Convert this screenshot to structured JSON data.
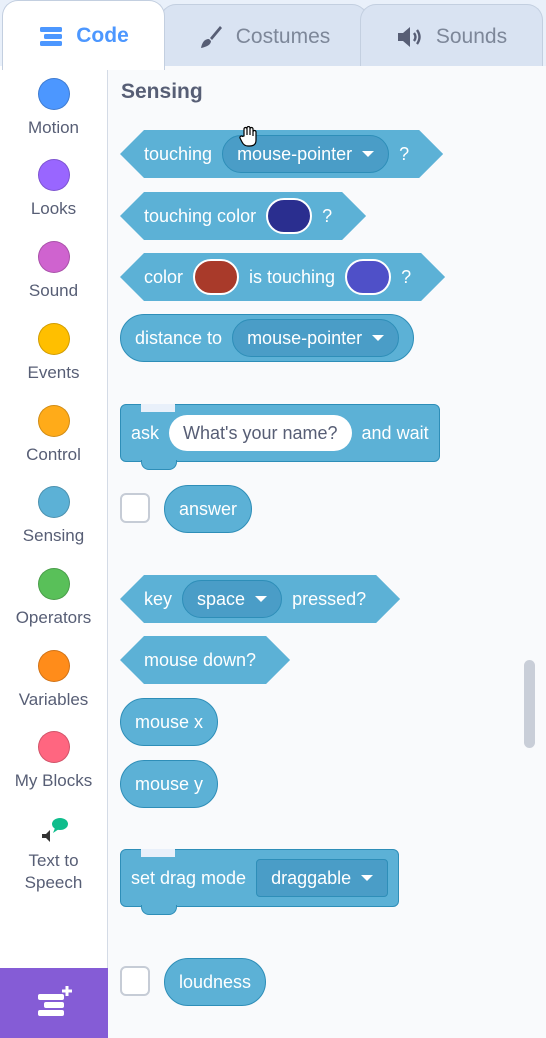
{
  "tabs": [
    {
      "label": "Code",
      "icon": "code-icon",
      "active": true
    },
    {
      "label": "Costumes",
      "icon": "brush-icon",
      "active": false
    },
    {
      "label": "Sounds",
      "icon": "speaker-icon",
      "active": false
    }
  ],
  "categories": [
    {
      "label": "Motion",
      "color": "#4c97ff"
    },
    {
      "label": "Looks",
      "color": "#9966ff"
    },
    {
      "label": "Sound",
      "color": "#cf63cf"
    },
    {
      "label": "Events",
      "color": "#ffbf00"
    },
    {
      "label": "Control",
      "color": "#ffab19"
    },
    {
      "label": "Sensing",
      "color": "#5cb1d6"
    },
    {
      "label": "Operators",
      "color": "#59c059"
    },
    {
      "label": "Variables",
      "color": "#ff8c1a"
    },
    {
      "label": "My Blocks",
      "color": "#ff6680"
    },
    {
      "label": "Text to Speech",
      "line1": "Text to",
      "line2": "Speech",
      "icon": "text-to-speech-icon"
    }
  ],
  "extension_button_icon": "add-extension-icon",
  "flyout": {
    "section_title": "Sensing",
    "accent_color": "#5cb1d6",
    "blocks": {
      "touching": {
        "text": "touching",
        "menu": "mouse-pointer",
        "suffix": "?"
      },
      "touching_color": {
        "text": "touching color",
        "swatch": "#3d3fae",
        "suffix": "?"
      },
      "color_touching": {
        "text": "color",
        "swatch1": "#a93a2a",
        "mid": "is touching",
        "swatch2": "#4f50c8",
        "suffix": "?"
      },
      "distance_to": {
        "text": "distance to",
        "menu": "mouse-pointer"
      },
      "ask": {
        "text": "ask",
        "input": "What's your name?",
        "suffix": "and wait"
      },
      "answer": {
        "text": "answer"
      },
      "key_pressed": {
        "text": "key",
        "menu": "space",
        "suffix": "pressed?"
      },
      "mouse_down": {
        "text": "mouse down?"
      },
      "mouse_x": {
        "text": "mouse x"
      },
      "mouse_y": {
        "text": "mouse y"
      },
      "drag_mode": {
        "text": "set drag mode",
        "menu": "draggable"
      },
      "loudness": {
        "text": "loudness"
      }
    }
  }
}
